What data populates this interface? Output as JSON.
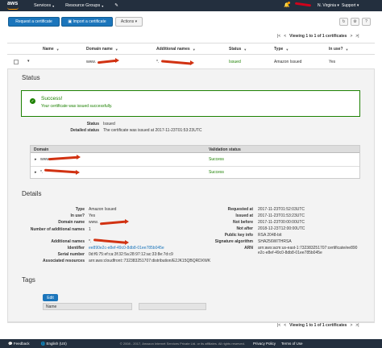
{
  "nav": {
    "logo": "aws",
    "services": "Services",
    "resource_groups": "Resource Groups",
    "region": "N. Virginia",
    "support": "Support",
    "account": "hidden"
  },
  "toolbar": {
    "request_cert": "Request a certificate",
    "import_cert": "Import a certificate",
    "actions": "Actions",
    "viewing": "Viewing 1 to 1 of 1 certificates"
  },
  "table": {
    "headers": [
      "Name",
      "Domain name",
      "Additional names",
      "Status",
      "Type",
      "In use?"
    ],
    "row": {
      "domain": "www.",
      "additional": "*.",
      "status": "Issued",
      "type": "Amazon Issued",
      "in_use": "Yes"
    }
  },
  "status_section": {
    "title": "Status",
    "success_title": "Success!",
    "success_msg": "Your certificate was issued successfully.",
    "status_label": "Status",
    "status_value": "Issued",
    "detailed_label": "Detailed status",
    "detailed_value": "The certificate was issued at 2017-11-23T01:53:23UTC",
    "domain_col": "Domain",
    "validation_col": "Validation status",
    "rows": [
      {
        "domain": "www.",
        "validation": "Success"
      },
      {
        "domain": "*.",
        "validation": "Success"
      }
    ]
  },
  "details": {
    "title": "Details",
    "left": [
      {
        "label": "Type",
        "value": "Amazon Issued"
      },
      {
        "label": "In use?",
        "value": "Yes"
      },
      {
        "label": "Domain name",
        "value": "www."
      },
      {
        "label": "Number of additional names",
        "value": "1"
      },
      {
        "label": "Additional names",
        "value": "*."
      },
      {
        "label": "Identifier",
        "value": "ee890e2c-e8ef-49c0-8db8-01ee785b045e"
      },
      {
        "label": "Serial number",
        "value": "0d:f6:75:ef:ca:3f:32:5a:28:97:12:ac:33:8e:7d:c9"
      },
      {
        "label": "Associated resources",
        "value": "arn:aws:cloudfront::732383251707:distribution/E2JK15QBQRDXWK"
      }
    ],
    "right": [
      {
        "label": "Requested at",
        "value": "2017-11-23T01:52:03UTC"
      },
      {
        "label": "Issued at",
        "value": "2017-11-23T01:53:23UTC"
      },
      {
        "label": "Not before",
        "value": "2017-11-23T00:00:00UTC"
      },
      {
        "label": "Not after",
        "value": "2018-12-23T12:00:00UTC"
      },
      {
        "label": "Public key info",
        "value": "RSA 2048-bit"
      },
      {
        "label": "Signature algorithm",
        "value": "SHA256WITHRSA"
      },
      {
        "label": "ARN",
        "value": "arn:aws:acm:us-east-1:732383251707:certificate/ee890e2c-e8ef-49c0-8db8-01ee785b045e"
      }
    ]
  },
  "tags": {
    "title": "Tags",
    "edit": "Edit",
    "name_header": "Name"
  },
  "footer": {
    "feedback": "Feedback",
    "language": "English (US)",
    "copyright": "© 2008 - 2017, Amazon Internet Services Private Ltd. or its affiliates. All rights reserved.",
    "privacy": "Privacy Policy",
    "terms": "Terms of Use"
  },
  "colors": {
    "nav": "#232f3e",
    "primary": "#1b75bb",
    "success": "#1d8102",
    "annotation": "#d13212"
  }
}
